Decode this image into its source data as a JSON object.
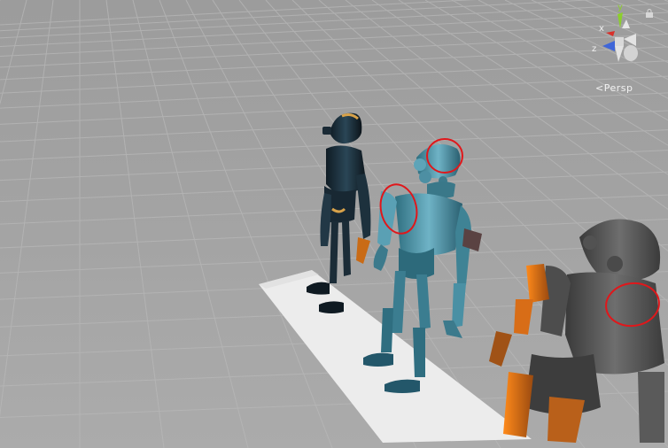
{
  "viewport": {
    "projection_label": "<Persp",
    "gizmo": {
      "y_label": "y",
      "x_label": "x",
      "z_label": "z"
    },
    "colors": {
      "background": "#a9a9a9",
      "grid_line": "#b8b8b8",
      "floor_plane": "#ececec",
      "annotation": "#e0171b",
      "gizmo_y": "#8ccf2c",
      "gizmo_x": "#d8302a",
      "gizmo_z": "#3f66d8"
    }
  },
  "scene": {
    "objects": [
      {
        "name": "robot-dark-blue"
      },
      {
        "name": "robot-light-blue"
      },
      {
        "name": "robot-grey-orange"
      }
    ],
    "annotations": [
      "head-circle",
      "left-arm-circle",
      "right-shoulder-circle"
    ]
  }
}
